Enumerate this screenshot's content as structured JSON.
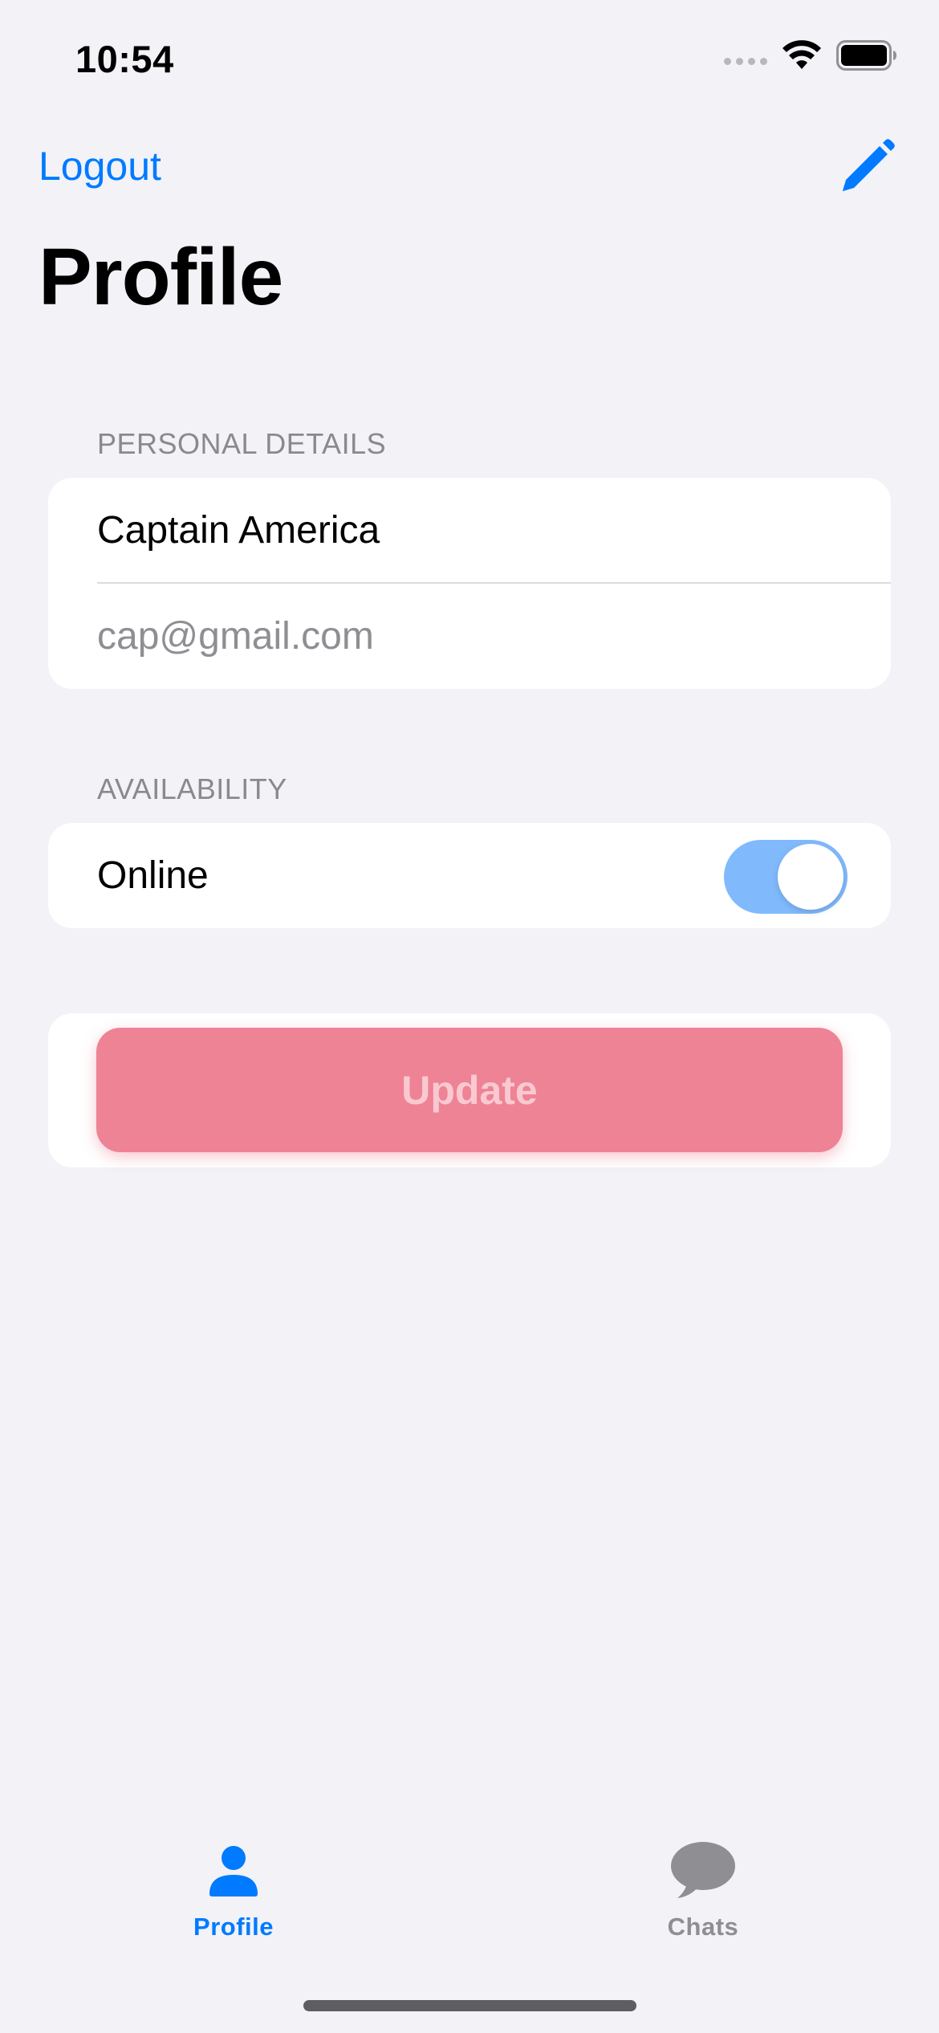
{
  "status_bar": {
    "time": "10:54"
  },
  "nav": {
    "logout_label": "Logout",
    "edit_icon": "pencil-icon",
    "title": "Profile"
  },
  "personal_details": {
    "header": "PERSONAL DETAILS",
    "name_value": "Captain America",
    "email_placeholder": "cap@gmail.com"
  },
  "availability": {
    "header": "AVAILABILITY",
    "online_label": "Online",
    "online_toggle_on": true
  },
  "update_button": {
    "label": "Update"
  },
  "tab_bar": {
    "items": [
      {
        "label": "Profile",
        "icon": "person-icon",
        "selected": true
      },
      {
        "label": "Chats",
        "icon": "chat-bubble-icon",
        "selected": false
      }
    ]
  },
  "colors": {
    "accent": "#007AFF",
    "background": "#F2F2F7",
    "update_button": "#EE8395",
    "tab_inactive": "#8E8E93"
  }
}
